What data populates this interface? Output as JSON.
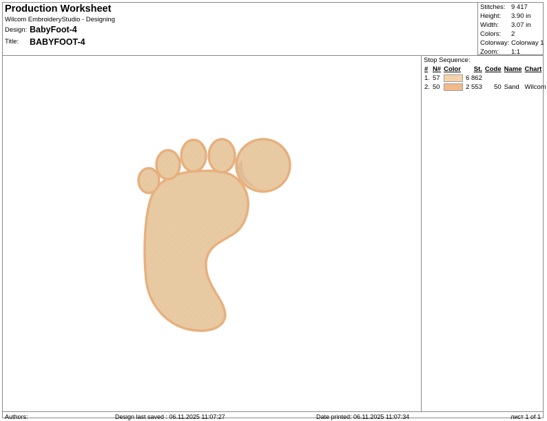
{
  "header": {
    "doc_title": "Production Worksheet",
    "app_line": "Wilcom EmbroideryStudio - Designing",
    "design_label": "Design:",
    "design_value": "BabyFoot-4",
    "title_label": "Title:",
    "title_value": "BABYFOOT-4"
  },
  "stats": [
    {
      "key": "Stitches:",
      "value": "9 417"
    },
    {
      "key": "Height:",
      "value": "3.90 in"
    },
    {
      "key": "Width:",
      "value": "3.07 in"
    },
    {
      "key": "Colors:",
      "value": "2"
    },
    {
      "key": "Colorway:",
      "value": "Colorway 1"
    },
    {
      "key": "Zoom:",
      "value": "1:1"
    }
  ],
  "stop_sequence": {
    "title": "Stop Sequence:",
    "headers": {
      "idx": "#",
      "num": "N#",
      "color": "Color",
      "st": "St.",
      "code": "Code",
      "name": "Name",
      "chart": "Chart"
    },
    "rows": [
      {
        "idx": "1.",
        "num": "57",
        "swatch": "#f6d2a8",
        "st": "6 862",
        "code": "",
        "name": "",
        "chart": ""
      },
      {
        "idx": "2.",
        "num": "50",
        "swatch": "#f3b98a",
        "st": "2 553",
        "code": "50",
        "name": "Sand",
        "chart": "Wilcom"
      }
    ]
  },
  "colors": {
    "fill": "#e9cba4",
    "outline": "#e7b07e",
    "shade": "#d8b08a"
  },
  "footer": {
    "authors": "Authors:",
    "saved": "Design last saved : 06.11.2025 11:07:27",
    "printed": "Date printed: 06.11.2025 11:07:34",
    "page": "лист 1 of 1"
  }
}
